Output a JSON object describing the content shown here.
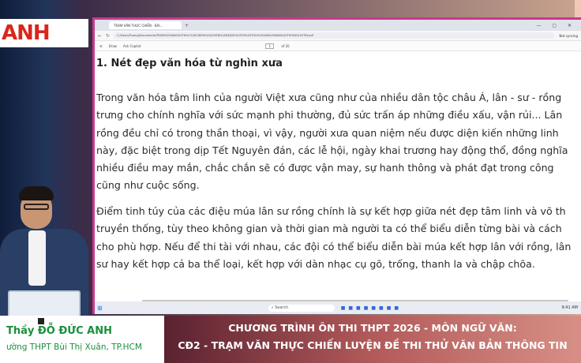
{
  "broadcaster": {
    "logo_text": "ANH NIÊN"
  },
  "browser": {
    "tab_title": "TRẠM VĂN THỰC CHIẾN - BÀI...",
    "tab_add": "+",
    "window_controls": "— ▢ ✕",
    "url": "C:/Users/Truong/Documents/TRAM%20VAN%20THUC%20CHIEN%20LUYEN%20DE/DE%20THI%20THU%20VAN%20BAN%20THONG%20TIN.pdf",
    "profile": "Not syncing"
  },
  "pdf_toolbar": {
    "draw_label": "Draw",
    "ask_label": "Ask Copilot",
    "page_current": "1",
    "page_total": "of 20"
  },
  "document": {
    "heading": "1. Nét đẹp văn hóa từ nghìn xưa",
    "paragraph1": [
      "Trong văn hóa tâm linh của người Việt xưa cũng như của nhiều dân tộc châu Á, lân - sư - rồng",
      "trưng cho chính nghĩa với sức mạnh phi thường, đủ sức trấn áp những điều xấu, vận rủi... Lân",
      "rồng đều chỉ có trong thần thoại, vì vậy, người xưa quan niệm nếu được diện kiến những linh",
      "này, đặc biệt trong dịp Tết Nguyên đán, các lễ hội, ngày khai trương hay động thổ, đồng nghĩa",
      "nhiều điều may mắn, chắc chắn sẽ có được vận may, sự hanh thông và phát đạt trong công",
      "cũng như cuộc sống."
    ],
    "paragraph2": [
      "Điểm tinh túy của các điệu múa lân sư rồng chính là sự kết hợp giữa nét đẹp tâm linh và võ th",
      "truyền thống, tùy theo không gian và thời gian mà người ta có thể biểu diễn từng bài và cách",
      "cho phù hợp. Nếu để thi tài với nhau, các đội có thể biểu diễn bài múa kết hợp lân với rồng, lân",
      "sư hay kết hợp cả ba thể loại, kết hợp với dàn nhạc cụ gõ, trống, thanh la và chập chõa."
    ]
  },
  "taskbar": {
    "search_placeholder": "Search",
    "tray": "9:41 AM"
  },
  "presenter": {
    "name": "Thầy ĐỖ ĐỨC ANH",
    "school": "ường THPT Bùi Thị Xuân, TP.HCM"
  },
  "banner": {
    "line1": "CHƯƠNG TRÌNH ÔN THI THPT 2026 - MÔN NGỮ VĂN:",
    "line2": "CĐ2 - TRẠM VĂN THỰC CHIẾN LUYỆN ĐỀ THI THỬ VĂN BẢN THÔNG TIN"
  },
  "colors": {
    "accent": "#c9398d",
    "name_green": "#1a8f3c",
    "logo_red": "#d9261c"
  }
}
